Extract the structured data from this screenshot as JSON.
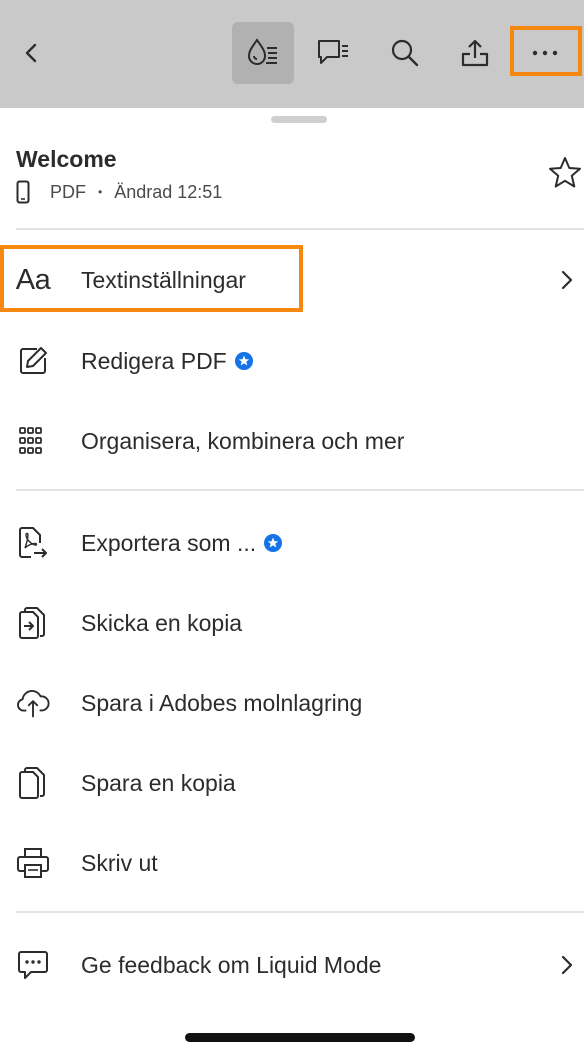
{
  "toolbar": {
    "back_icon": "chevron-left-icon",
    "liquid_mode_icon": "liquid-mode-icon",
    "comment_icon": "comment-icon",
    "search_icon": "search-icon",
    "share_icon": "share-icon",
    "more_icon": "more-horizontal-icon"
  },
  "document": {
    "title": "Welcome",
    "device_icon": "phone-icon",
    "type": "PDF",
    "separator": "•",
    "modified": "Ändrad 12:51"
  },
  "menu": {
    "text_settings": {
      "icon_text": "Aa",
      "label": "Textinställningar"
    },
    "edit_pdf": {
      "label": "Redigera PDF"
    },
    "organize": {
      "label": "Organisera, kombinera och mer"
    },
    "export": {
      "label": "Exportera som ..."
    },
    "send_copy": {
      "label": "Skicka en kopia"
    },
    "save_cloud": {
      "label": "Spara i Adobes molnlagring"
    },
    "save_copy": {
      "label": "Spara en kopia"
    },
    "print": {
      "label": "Skriv ut"
    },
    "feedback": {
      "label": "Ge feedback om Liquid Mode"
    }
  },
  "colors": {
    "highlight": "#f5890f",
    "premium_badge": "#1473e6",
    "toolbar_bg": "#c9c9c9"
  }
}
